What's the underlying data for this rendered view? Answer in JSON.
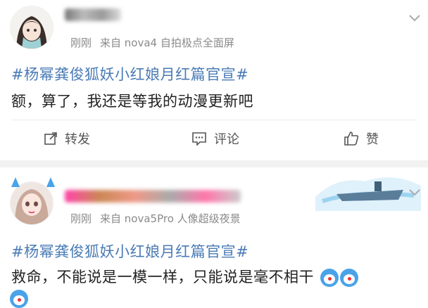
{
  "post1": {
    "time": "刚刚",
    "source": "来自 nova4 自拍极点全面屏",
    "topic": "#杨幂龚俊狐妖小红娘月红篇官宣#",
    "text": "额，算了，我还是等我的动漫更新吧",
    "actions": {
      "repost": "转发",
      "comment": "评论",
      "like": "赞"
    }
  },
  "post2": {
    "time": "刚刚",
    "source": "来自 nova5Pro 人像超级夜景",
    "topic": "#杨幂龚俊狐妖小红娘月红篇官宣#",
    "text": "救命，不能说是一模一样，只能说是毫不相干"
  },
  "colors": {
    "topic": "#4a7bb5",
    "meta": "#8a8a8a",
    "gap": "#f2f2f2"
  },
  "icons": [
    "avatar-girl",
    "chevron-down-icon",
    "share-icon",
    "comment-icon",
    "thumb-up-icon",
    "doraemon-emoji",
    "aircraft-carrier-badge"
  ]
}
